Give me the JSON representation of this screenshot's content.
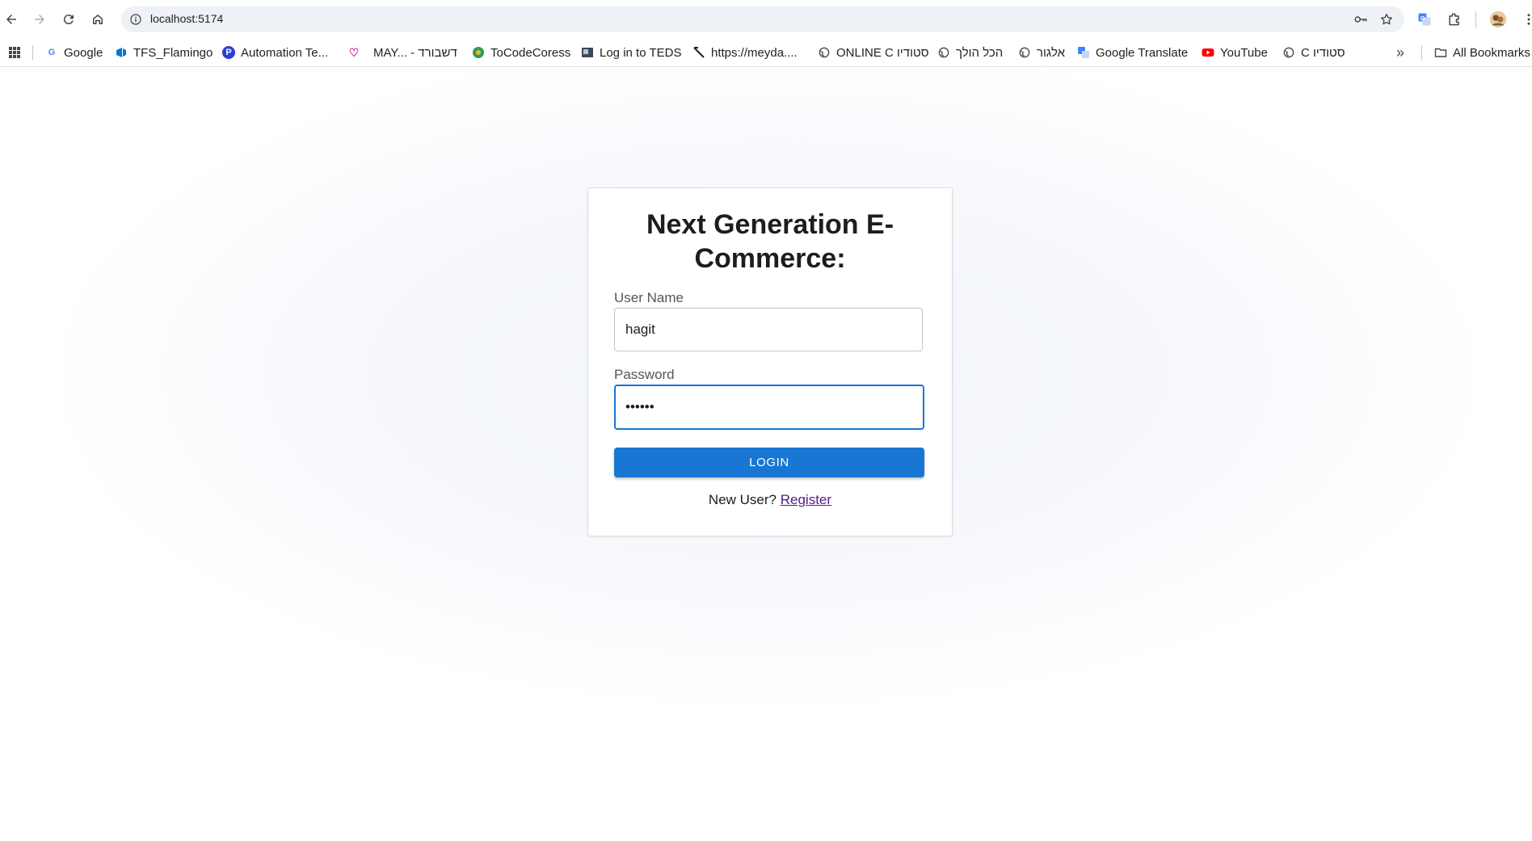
{
  "browser": {
    "url": "localhost:5174",
    "bookmarks": [
      {
        "label": "Google",
        "icon": "google-icon"
      },
      {
        "label": "TFS_Flamingo",
        "icon": "azure-devops-icon"
      },
      {
        "label": "Automation Te...",
        "icon": "p-circle-icon"
      },
      {
        "label": "MAY... - דשבורד",
        "icon": "heart-icon"
      },
      {
        "label": "ToCodeCoress",
        "icon": "tocode-icon"
      },
      {
        "label": "Log in to TEDS",
        "icon": "teds-icon"
      },
      {
        "label": "https://meyda....",
        "icon": "x-slash-icon"
      },
      {
        "label": "ONLINE C סטודיו",
        "icon": "globe-icon"
      },
      {
        "label": "הכל הולך",
        "icon": "globe-icon"
      },
      {
        "label": "אלגור",
        "icon": "globe-icon"
      },
      {
        "label": "Google Translate",
        "icon": "google-translate-icon"
      },
      {
        "label": "YouTube",
        "icon": "youtube-icon"
      },
      {
        "label": "C סטודיו",
        "icon": "globe-icon"
      }
    ],
    "all_bookmarks_label": "All Bookmarks",
    "overflow_label": "»"
  },
  "login": {
    "title": "Next Generation E-Commerce:",
    "username_label": "User Name",
    "username_value": "hagit",
    "password_label": "Password",
    "password_value": "••••••",
    "login_button": "LOGIN",
    "new_user_text": "New User?",
    "register_link": "Register"
  },
  "colors": {
    "primary": "#1976d2",
    "link_visited": "#551a8b"
  }
}
